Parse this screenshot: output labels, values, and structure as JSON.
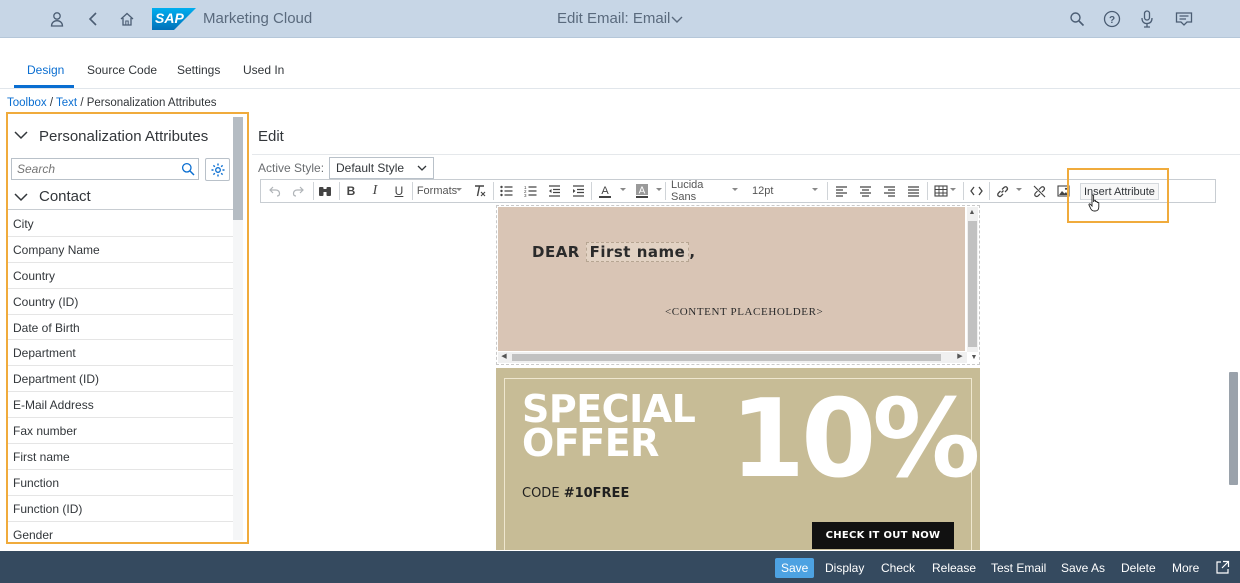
{
  "shell": {
    "brand": "Marketing Cloud",
    "logo_text": "SAP",
    "title": "Edit Email: Email",
    "icons": [
      "user-icon",
      "back-icon",
      "home-icon",
      "search-icon",
      "help-icon",
      "microphone-icon",
      "notifications-icon"
    ]
  },
  "tabs": [
    "Design",
    "Source Code",
    "Settings",
    "Used In"
  ],
  "breadcrumb": {
    "link1": "Toolbox",
    "sep1": " / ",
    "link2": "Text",
    "sep2": " / ",
    "current": "Personalization Attributes"
  },
  "left_panel": {
    "title": "Personalization Attributes",
    "search_placeholder": "Search",
    "group": "Contact",
    "items": [
      "City",
      "Company Name",
      "Country",
      "Country (ID)",
      "Date of Birth",
      "Department",
      "Department (ID)",
      "E-Mail Address",
      "Fax number",
      "First name",
      "Function",
      "Function (ID)",
      "Gender"
    ]
  },
  "editor": {
    "title": "Edit",
    "active_style_label": "Active Style:",
    "active_style_value": "Default Style",
    "toolbar": {
      "formats": "Formats",
      "font": "Lucida Sans",
      "size": "12pt",
      "insert_attribute": "Insert Attribute"
    }
  },
  "email": {
    "greeting_prefix": "DEAR",
    "greeting_attr": "First name",
    "greeting_suffix": ",",
    "placeholder": "<CONTENT PLACEHOLDER>",
    "offer_line1": "SPECIAL",
    "offer_line2": "OFFER",
    "offer_percent": "10%",
    "code_label": "CODE",
    "code_value": "#10FREE",
    "cta": "CHECK IT OUT NOW",
    "colors": {
      "header_bg": "#d9c5b5",
      "offer_bg": "#c7bc96"
    }
  },
  "footer": {
    "buttons": [
      "Save",
      "Display",
      "Check",
      "Release",
      "Test Email",
      "Save As",
      "Delete",
      "More"
    ]
  },
  "colors": {
    "accent": "#0a6ed1",
    "highlight": "#f0ab3c",
    "footer_bg": "#354a5f",
    "shell_bg": "#c7d6e6"
  }
}
